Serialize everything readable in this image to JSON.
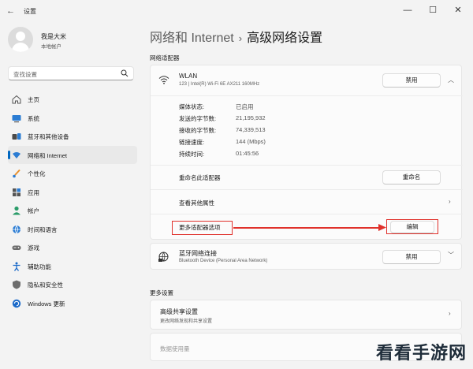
{
  "window": {
    "title": "设置",
    "minimize_glyph": "—",
    "maximize_glyph": "☐",
    "close_glyph": "✕"
  },
  "profile": {
    "name": "我是大米",
    "account_type": "本地帐户"
  },
  "search": {
    "placeholder": "查找设置"
  },
  "sidebar": {
    "items": [
      {
        "label": "主页",
        "icon": "home-icon"
      },
      {
        "label": "系统",
        "icon": "system-icon"
      },
      {
        "label": "蓝牙和其他设备",
        "icon": "bluetooth-icon"
      },
      {
        "label": "网络和 Internet",
        "icon": "network-icon",
        "active": true
      },
      {
        "label": "个性化",
        "icon": "brush-icon"
      },
      {
        "label": "应用",
        "icon": "apps-icon"
      },
      {
        "label": "帐户",
        "icon": "account-icon"
      },
      {
        "label": "时间和语言",
        "icon": "globe-icon"
      },
      {
        "label": "游戏",
        "icon": "gamepad-icon"
      },
      {
        "label": "辅助功能",
        "icon": "accessibility-icon"
      },
      {
        "label": "隐私和安全性",
        "icon": "shield-icon"
      },
      {
        "label": "Windows 更新",
        "icon": "update-icon"
      }
    ]
  },
  "breadcrumb": {
    "parent": "网络和 Internet",
    "separator": "›",
    "current": "高级网络设置"
  },
  "sections": {
    "adapters": "网络适配器",
    "more_settings": "更多设置"
  },
  "wlan": {
    "name": "WLAN",
    "description": "123 | Intel(R) Wi-Fi 6E AX211 160MHz",
    "disable_label": "禁用",
    "properties": [
      {
        "key": "媒体状态:",
        "value": "已启用"
      },
      {
        "key": "发送的字节数:",
        "value": "21,195,932"
      },
      {
        "key": "接收的字节数:",
        "value": "74,339,513"
      },
      {
        "key": "链接速度:",
        "value": "144 (Mbps)"
      },
      {
        "key": "持续时间:",
        "value": "01:45:56"
      }
    ],
    "rename_label": "重命名此适配器",
    "rename_button": "重命名",
    "more_properties_label": "查看其他属性",
    "more_options_label": "更多适配器选项",
    "edit_button": "编辑"
  },
  "bluetooth": {
    "name": "蓝牙网络连接",
    "description": "Bluetooth Device (Personal Area Network)",
    "disable_label": "禁用"
  },
  "more": {
    "sharing_title": "高级共享设置",
    "sharing_sub": "更改网络发现和共享设置",
    "data_usage": "数据使用量"
  },
  "colors": {
    "accent": "#0067c0",
    "highlight": "#e0312b"
  },
  "watermark": "看看手游网"
}
